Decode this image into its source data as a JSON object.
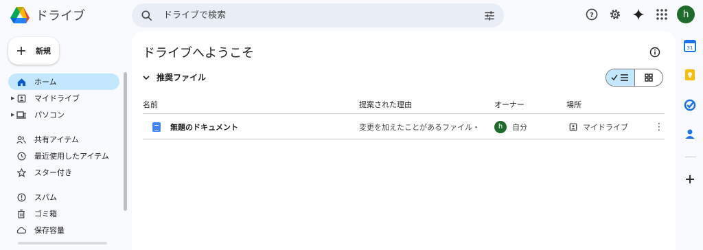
{
  "app": {
    "title": "ドライブ"
  },
  "search": {
    "placeholder": "ドライブで検索"
  },
  "header_icons": [
    "help-icon",
    "settings-icon",
    "gemini-icon",
    "apps-grid-icon"
  ],
  "user": {
    "initial": "h",
    "avatar_color": "#1e6b2b"
  },
  "new_button": {
    "label": "新規"
  },
  "sidebar": {
    "items": [
      {
        "label": "ホーム",
        "icon": "home-icon",
        "active": true
      },
      {
        "label": "マイドライブ",
        "icon": "my-drive-icon",
        "expandable": true
      },
      {
        "label": "パソコン",
        "icon": "computers-icon",
        "expandable": true
      },
      {
        "label": "共有アイテム",
        "icon": "shared-icon"
      },
      {
        "label": "最近使用したアイテム",
        "icon": "recent-icon"
      },
      {
        "label": "スター付き",
        "icon": "star-icon"
      },
      {
        "label": "スパム",
        "icon": "spam-icon"
      },
      {
        "label": "ゴミ箱",
        "icon": "trash-icon"
      },
      {
        "label": "保存容量",
        "icon": "cloud-icon"
      }
    ]
  },
  "main": {
    "title": "ドライブへようこそ",
    "section_label": "推奨ファイル",
    "columns": {
      "name": "名前",
      "reason": "提案された理由",
      "owner": "オーナー",
      "location": "場所"
    },
    "rows": [
      {
        "name": "無題のドキュメント",
        "reason": "変更を加えたことがあるファイル・",
        "owner": "自分",
        "owner_initial": "h",
        "location": "マイドライブ"
      }
    ]
  },
  "colors": {
    "accent": "#c2e7ff",
    "background": "#f8fafd",
    "docs_blue": "#4285f4"
  }
}
